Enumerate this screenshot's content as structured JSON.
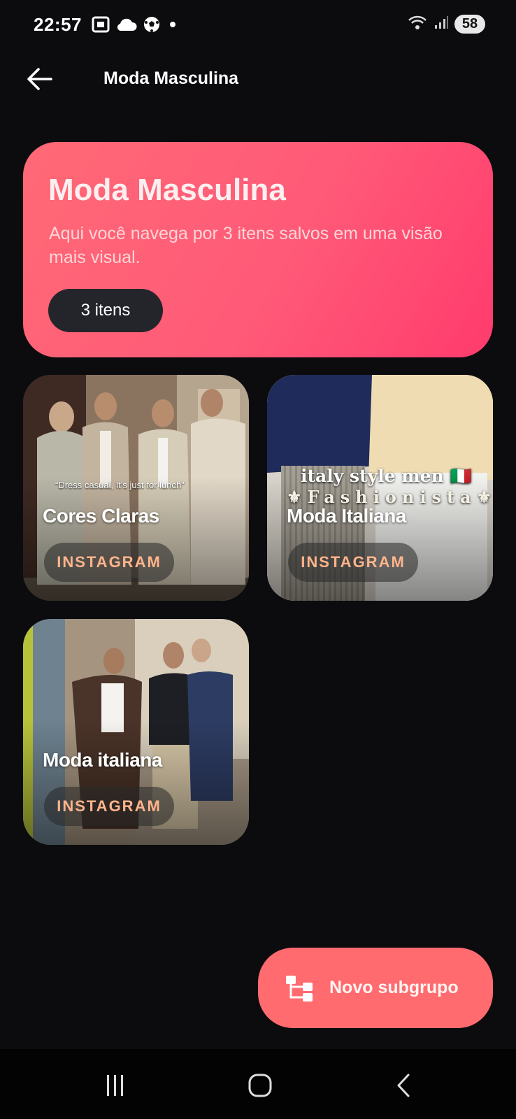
{
  "status_bar": {
    "time": "22:57",
    "icons_left": [
      "screenshot-icon",
      "cloud-icon",
      "soccer-ball-icon",
      "dot-icon"
    ],
    "icons_right": [
      "wifi-icon",
      "signal-icon"
    ],
    "battery": "58"
  },
  "top_bar": {
    "title": "Moda Masculina"
  },
  "hero": {
    "title": "Moda Masculina",
    "description": "Aqui você navega por 3 itens salvos em uma visão mais visual.",
    "count_chip": "3 itens",
    "gradient": [
      "#ff6976",
      "#ff3b6d"
    ]
  },
  "items": [
    {
      "title": "Cores Claras",
      "source": "INSTAGRAM",
      "caption": "“Dress casual, It's just for lunch”"
    },
    {
      "title": "Moda Italiana",
      "source": "INSTAGRAM",
      "caption_line1": "italy style men 🇮🇹",
      "caption_line2": "⚜Fashionista⚜"
    },
    {
      "title": "Moda italiana",
      "source": "INSTAGRAM"
    }
  ],
  "fab": {
    "label": "Novo subgrupo",
    "icon": "subgroup-tree-icon",
    "color": "#ff6b6f"
  },
  "nav": {
    "recent": "recent-apps-icon",
    "home": "home-icon",
    "back": "back-icon"
  }
}
